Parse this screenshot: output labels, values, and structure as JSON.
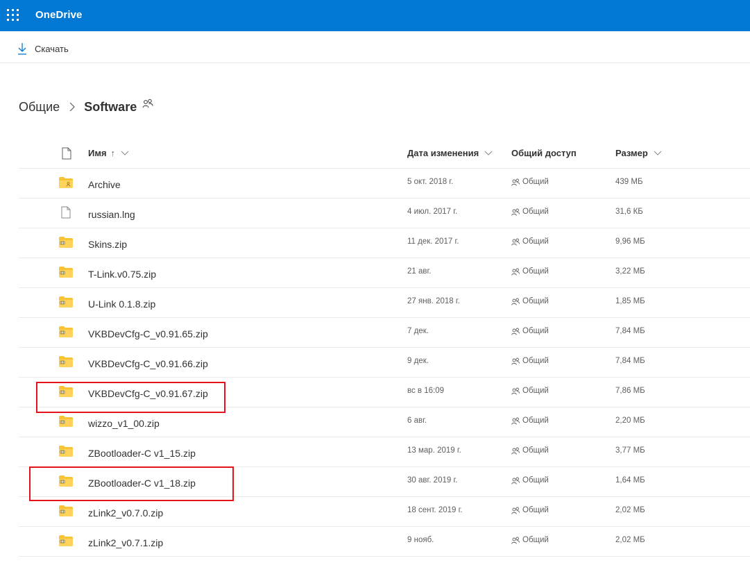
{
  "app": {
    "title": "OneDrive"
  },
  "toolbar": {
    "download_label": "Скачать"
  },
  "breadcrumb": {
    "root": "Общие",
    "current": "Software"
  },
  "columns": {
    "name": "Имя",
    "sort_arrow": "↑",
    "modified": "Дата изменения",
    "sharing": "Общий доступ",
    "size": "Размер"
  },
  "files": [
    {
      "type": "shared-folder",
      "name": "Archive",
      "modified": "5 окт. 2018 г.",
      "sharing": "Общий",
      "size": "439 МБ"
    },
    {
      "type": "file",
      "name": "russian.lng",
      "modified": "4 июл. 2017 г.",
      "sharing": "Общий",
      "size": "31,6 КБ"
    },
    {
      "type": "zip",
      "name": "Skins.zip",
      "modified": "11 дек. 2017 г.",
      "sharing": "Общий",
      "size": "9,96 МБ"
    },
    {
      "type": "zip",
      "name": "T-Link.v0.75.zip",
      "modified": "21 авг.",
      "sharing": "Общий",
      "size": "3,22 МБ"
    },
    {
      "type": "zip",
      "name": "U-Link 0.1.8.zip",
      "modified": "27 янв. 2018 г.",
      "sharing": "Общий",
      "size": "1,85 МБ"
    },
    {
      "type": "zip",
      "name": "VKBDevCfg-C_v0.91.65.zip",
      "modified": "7 дек.",
      "sharing": "Общий",
      "size": "7,84 МБ"
    },
    {
      "type": "zip",
      "name": "VKBDevCfg-C_v0.91.66.zip",
      "modified": "9 дек.",
      "sharing": "Общий",
      "size": "7,84 МБ"
    },
    {
      "type": "zip",
      "name": "VKBDevCfg-C_v0.91.67.zip",
      "modified": "вс в 16:09",
      "sharing": "Общий",
      "size": "7,86 МБ"
    },
    {
      "type": "zip",
      "name": "wizzo_v1_00.zip",
      "modified": "6 авг.",
      "sharing": "Общий",
      "size": "2,20 МБ"
    },
    {
      "type": "zip",
      "name": "ZBootloader-C v1_15.zip",
      "modified": "13 мар. 2019 г.",
      "sharing": "Общий",
      "size": "3,77 МБ"
    },
    {
      "type": "zip",
      "name": "ZBootloader-C v1_18.zip",
      "modified": "30 авг. 2019 г.",
      "sharing": "Общий",
      "size": "1,64 МБ"
    },
    {
      "type": "zip",
      "name": "zLink2_v0.7.0.zip",
      "modified": "18 сент. 2019 г.",
      "sharing": "Общий",
      "size": "2,02 МБ"
    },
    {
      "type": "zip",
      "name": "zLink2_v0.7.1.zip",
      "modified": "9 нояб.",
      "sharing": "Общий",
      "size": "2,02 МБ"
    }
  ],
  "highlighted_files": [
    "VKBDevCfg-C_v0.91.67.zip",
    "ZBootloader-C v1_18.zip"
  ],
  "colors": {
    "brand": "#0078d4",
    "highlight": "#e3131b",
    "folder": "#f8c335"
  }
}
